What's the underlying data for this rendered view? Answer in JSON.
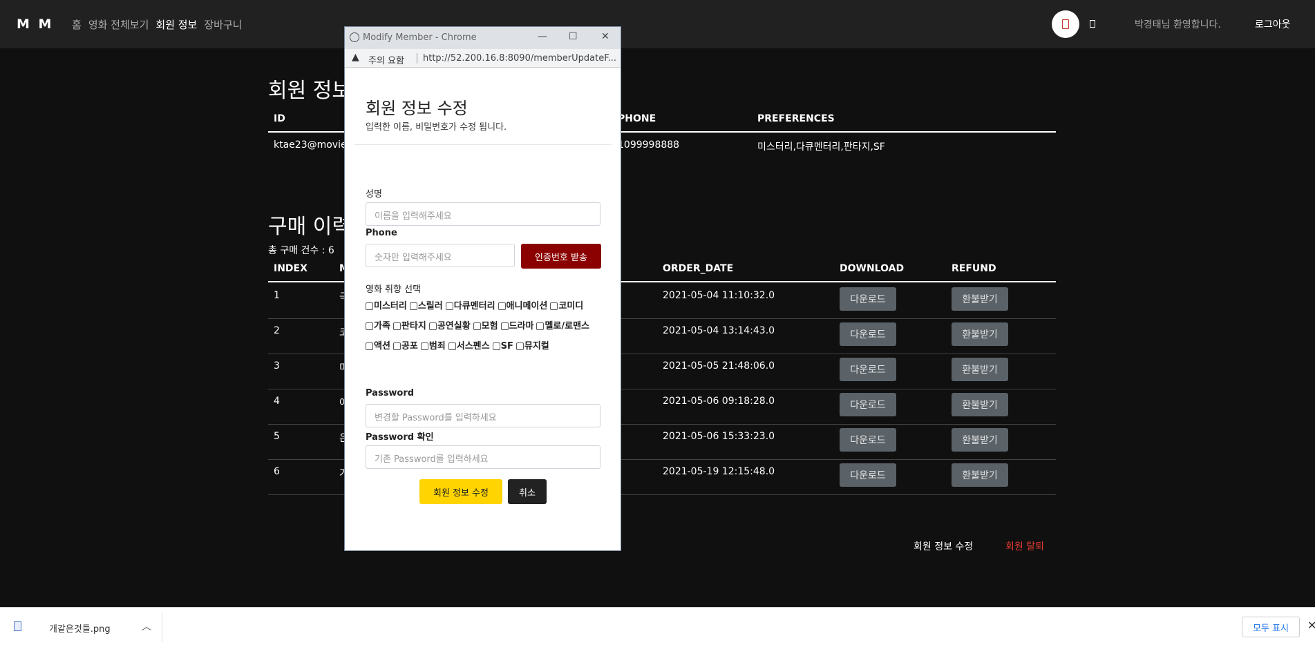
{
  "nav": {
    "brand": "M M",
    "links": [
      {
        "label": "홈",
        "active": false
      },
      {
        "label": "영화 전체보기",
        "active": false
      },
      {
        "label": "회원 정보",
        "active": true
      },
      {
        "label": "장바구니",
        "active": false
      }
    ],
    "welcome": "박경태님 환영합니다.",
    "logout": "로그아웃"
  },
  "member_section": {
    "title": "회원 정보",
    "headers": {
      "id": "ID",
      "phone": "PHONE",
      "preferences": "PREFERENCES"
    },
    "row": {
      "id": "ktae23@moviem",
      "phone": "1099998888",
      "preferences": "미스터리,다큐멘터리,판타지,SF"
    }
  },
  "purchase_section": {
    "title": "구매 이력",
    "total": "총 구매 건수 : 6",
    "headers": {
      "index": "INDEX",
      "m": "M",
      "order_date": "ORDER_DATE",
      "download": "DOWNLOAD",
      "refund": "REFUND"
    },
    "rows": [
      {
        "index": "1",
        "m": "극",
        "date": "2021-05-04 11:10:32.0"
      },
      {
        "index": "2",
        "m": "코",
        "date": "2021-05-04 13:14:43.0"
      },
      {
        "index": "3",
        "m": "미",
        "date": "2021-05-05 21:48:06.0"
      },
      {
        "index": "4",
        "m": "어",
        "date": "2021-05-06 09:18:28.0"
      },
      {
        "index": "5",
        "m": "은",
        "date": "2021-05-06 15:33:23.0"
      },
      {
        "index": "6",
        "m": "가",
        "date": "2021-05-19 12:15:48.0"
      }
    ],
    "download_label": "다운로드",
    "refund_label": "환불받기"
  },
  "footer": {
    "edit": "회원 정보 수정",
    "delete": "회원 탈퇴"
  },
  "popup": {
    "window_title": "Modify Member - Chrome",
    "controls": {
      "minimize": "—",
      "maximize": "☐",
      "close": "✕"
    },
    "warning_icon": "▲",
    "warning_text": "주의 요함",
    "url": "http://52.200.16.8:8090/memberUpdateF...",
    "title": "회원 정보 수정",
    "subtitle": "입력한 이름, 비밀번호가 수정 됩니다.",
    "name_label": "성명",
    "name_placeholder": "이름을 입력해주세요",
    "phone_label": "Phone",
    "phone_placeholder": "숫자만 입력해주세요",
    "send_code": "인증번호 받송",
    "pref_title": "영화 취향 선택",
    "preferences": [
      "미스터리",
      "스릴러",
      "다큐멘터리",
      "애니메이션",
      "코미디",
      "가족",
      "판타지",
      "공연실황",
      "모험",
      "드라마",
      "멜로/로맨스",
      "액션",
      "공포",
      "범죄",
      "서스펜스",
      "SF",
      "뮤지컬"
    ],
    "password_label": "Password",
    "password_placeholder": "변경할 Password를 입력하세요",
    "password_confirm_label": "Password 확인",
    "password_confirm_placeholder": "기존 Password를 입력하세요",
    "submit": "회원 정보 수정",
    "cancel": "취소"
  },
  "download_bar": {
    "filename": "개같은것들.png",
    "chevron": "︿",
    "show_all": "모두 표시",
    "close": "✕"
  }
}
